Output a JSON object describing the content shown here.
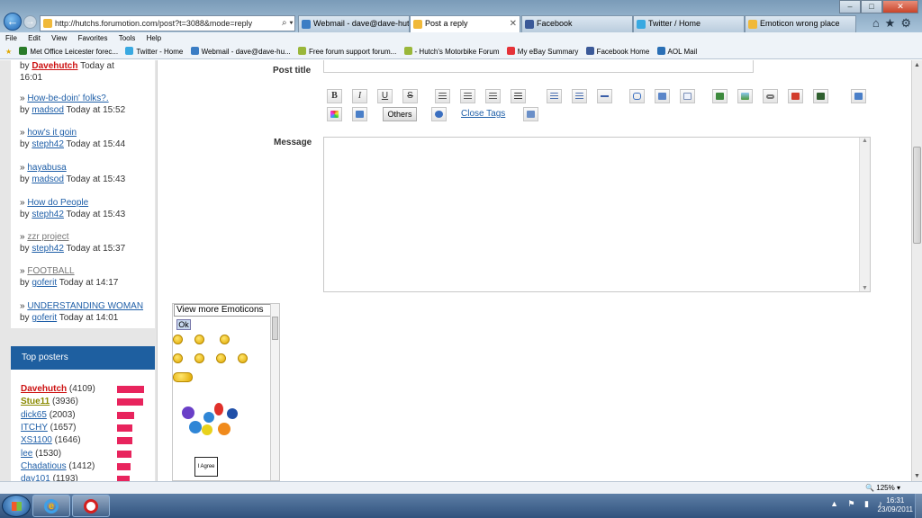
{
  "browser": {
    "address": "http://hutchs.forumotion.com/post?t=3088&mode=reply",
    "address_tools": "⌕ ▾ ↻ ✕",
    "tabs": [
      {
        "label": "Webmail - dave@dave-hutchi...",
        "icon_color": "#3b7dc4"
      },
      {
        "label": "Post a reply",
        "icon_color": "#f0b93a",
        "active": true
      },
      {
        "label": "Facebook",
        "icon_color": "#3b5998"
      },
      {
        "label": "Twitter / Home",
        "icon_color": "#39a9e1"
      },
      {
        "label": "Emoticon wrong place",
        "icon_color": "#f0b93a"
      }
    ],
    "tab_close": "✕",
    "window_controls": {
      "minimize": "–",
      "maximize": "□",
      "close": "✕"
    },
    "right_icons": "⌂★⚙",
    "menu": [
      "File",
      "Edit",
      "View",
      "Favorites",
      "Tools",
      "Help"
    ],
    "favorites": [
      {
        "label": "Met Office Leicester forec...",
        "icon_color": "#2a7c2a"
      },
      {
        "label": "Twitter - Home",
        "icon_color": "#39a9e1"
      },
      {
        "label": "Webmail - dave@dave-hu...",
        "icon_color": "#3b7dc4"
      },
      {
        "label": "Free forum support forum...",
        "icon_color": "#9ab73a"
      },
      {
        "label": "- Hutch's Motorbike Forum",
        "icon_color": "#9ab73a"
      },
      {
        "label": "My eBay Summary",
        "icon_color": "#e53238"
      },
      {
        "label": "Facebook Home",
        "icon_color": "#3b5998"
      },
      {
        "label": "AOL Mail",
        "icon_color": "#2a6fb5"
      }
    ]
  },
  "sidebar": {
    "topics": [
      {
        "title": "",
        "by": "by",
        "author": "Davehutch",
        "author_red": true,
        "time": "Today at",
        "time2": "16:01"
      },
      {
        "title": "How-be-doin' folks?.",
        "by": "by",
        "author": "madsod",
        "time": "Today at 15:52"
      },
      {
        "title": "how's it goin",
        "by": "by",
        "author": "steph42",
        "time": "Today at 15:44"
      },
      {
        "title": "hayabusa",
        "by": "by",
        "author": "madsod",
        "time": "Today at 15:43"
      },
      {
        "title": "How do People",
        "by": "by",
        "author": "steph42",
        "time": "Today at 15:43"
      },
      {
        "title": "zzr project",
        "by": "by",
        "author": "steph42",
        "time": "Today at 15:37"
      },
      {
        "title": "FOOTBALL",
        "by": "by",
        "author": "goferit",
        "time": "Today at 14:17"
      },
      {
        "title": "UNDERSTANDING WOMAN",
        "by": "by",
        "author": "goferit",
        "time": "Today at 14:01"
      }
    ],
    "topic_prefix": "»",
    "top_posters_title": "Top posters",
    "top_posters": [
      {
        "name": "Davehutch",
        "count": "(4109)",
        "color": "#cc1111",
        "bold": true,
        "fill": 1.0
      },
      {
        "name": "Stue11",
        "count": "(3936)",
        "color": "#8a8a00",
        "bold": true,
        "fill": 0.96
      },
      {
        "name": "dick65",
        "count": "(2003)",
        "color": "#1f5fa8",
        "fill": 0.62
      },
      {
        "name": "ITCHY",
        "count": "(1657)",
        "color": "#1f5fa8",
        "fill": 0.55
      },
      {
        "name": "XS1100",
        "count": "(1646)",
        "color": "#1f5fa8",
        "fill": 0.55
      },
      {
        "name": "lee",
        "count": "(1530)",
        "color": "#1f5fa8",
        "fill": 0.52
      },
      {
        "name": "Chadatious",
        "count": "(1412)",
        "color": "#1f5fa8",
        "fill": 0.5
      },
      {
        "name": "day101",
        "count": "(1193)",
        "color": "#1f5fa8",
        "fill": 0.47
      }
    ]
  },
  "editor": {
    "post_title_label": "Post title",
    "message_label": "Message",
    "bold": "B",
    "italic": "I",
    "underline": "U",
    "strike": "S",
    "others_label": "Others",
    "close_tags_label": "Close Tags",
    "emoticons": {
      "selector_value": "View more Emoticons",
      "ok_label": "Ok",
      "sign_text": "I Agree"
    }
  },
  "statusbar": {
    "zoom": "125%"
  },
  "taskbar": {
    "time": "16:31",
    "date": "23/09/2011",
    "tray_icons": "▲ ⚑ ▮ ♪"
  }
}
